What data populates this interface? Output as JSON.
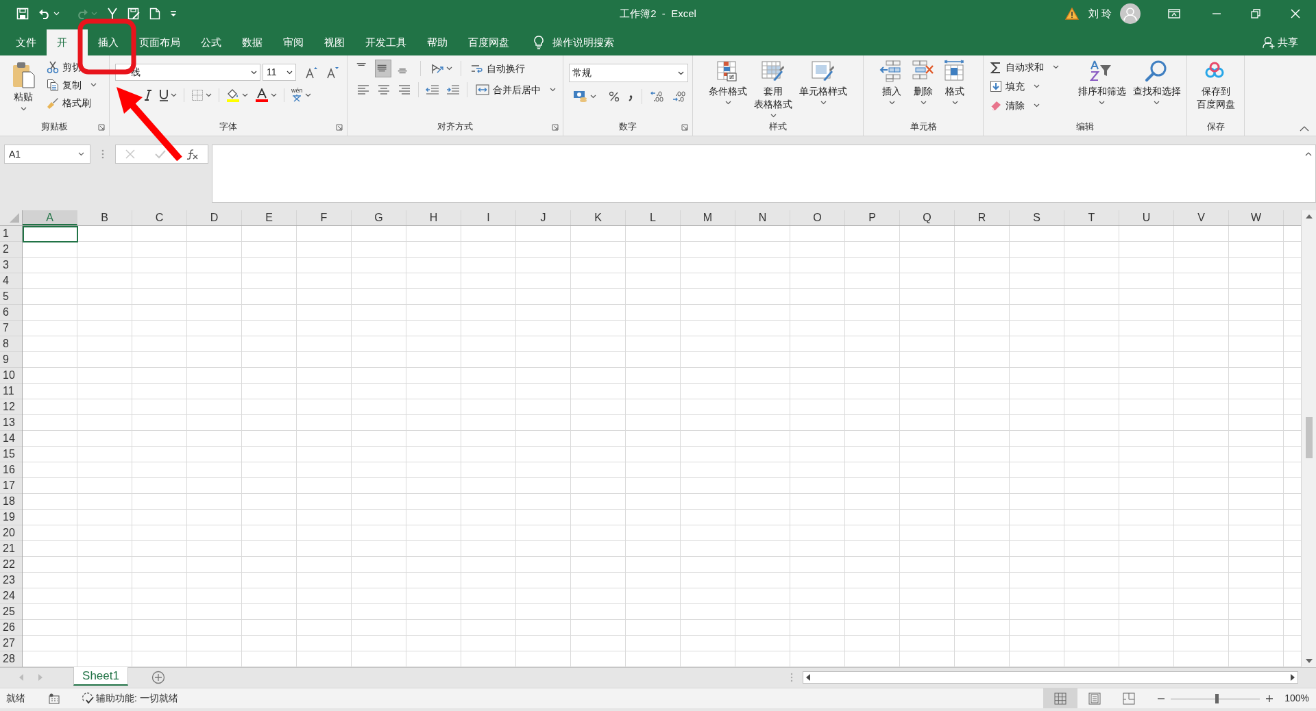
{
  "window": {
    "title": "工作簿2  -  Excel",
    "user": "刘 玲"
  },
  "menu_tabs": [
    {
      "label": "文件",
      "selected": false
    },
    {
      "label": "开",
      "selected": true
    },
    {
      "label": "插入",
      "selected": false
    },
    {
      "label": "页面布局",
      "selected": false
    },
    {
      "label": "公式",
      "selected": false
    },
    {
      "label": "数据",
      "selected": false
    },
    {
      "label": "审阅",
      "selected": false
    },
    {
      "label": "视图",
      "selected": false
    },
    {
      "label": "开发工具",
      "selected": false
    },
    {
      "label": "帮助",
      "selected": false
    },
    {
      "label": "百度网盘",
      "selected": false
    }
  ],
  "tell_me": "操作说明搜索",
  "share": "共享",
  "ribbon_groups": [
    {
      "kind": "clipboard",
      "title": "剪贴板",
      "paste": "粘贴",
      "small": [
        {
          "label": "剪切",
          "dropdown": false
        },
        {
          "label": "复制",
          "dropdown": true
        },
        {
          "label": "格式刷",
          "dropdown": false
        }
      ]
    },
    {
      "kind": "font",
      "title": "字体",
      "font": "线",
      "size": "11",
      "wen": "wén"
    },
    {
      "kind": "alignment",
      "title": "对齐方式",
      "vertical_align": [
        {
          "selected": false
        },
        {
          "selected": true
        },
        {
          "selected": false
        }
      ],
      "wrap": "自动换行",
      "merge": "合并后居中"
    },
    {
      "kind": "number",
      "title": "数字",
      "format": "常规"
    },
    {
      "kind": "buttons",
      "title": "样式",
      "items": [
        {
          "kind": "large",
          "label": "条件格式",
          "dropdown": true
        },
        {
          "kind": "large",
          "lines": [
            "套用",
            "表格格式"
          ],
          "dropdown": true
        },
        {
          "kind": "large",
          "label": "单元格样式",
          "dropdown": true
        }
      ]
    },
    {
      "kind": "buttons",
      "title": "单元格",
      "items": [
        {
          "kind": "large",
          "label": "插入",
          "dropdown": true
        },
        {
          "kind": "large",
          "label": "删除",
          "dropdown": true
        },
        {
          "kind": "large",
          "label": "格式",
          "dropdown": true
        }
      ]
    },
    {
      "kind": "buttons",
      "title": "编辑",
      "items": [
        {
          "kind": "stack",
          "items": [
            {
              "label": "自动求和",
              "dropdown": true
            },
            {
              "label": "填充",
              "dropdown": true
            },
            {
              "label": "清除",
              "dropdown": true
            }
          ]
        },
        {
          "kind": "large",
          "label": "排序和筛选",
          "dropdown": true
        },
        {
          "kind": "large",
          "label": "查找和选择",
          "dropdown": true
        }
      ]
    },
    {
      "kind": "buttons",
      "title": "保存",
      "items": [
        {
          "kind": "large",
          "lines": [
            "保存到",
            "百度网盘"
          ],
          "dropdown": false
        }
      ]
    }
  ],
  "name_box": "A1",
  "columns": [
    {
      "label": "A",
      "selected": true
    },
    {
      "label": "B",
      "selected": false
    },
    {
      "label": "C",
      "selected": false
    },
    {
      "label": "D",
      "selected": false
    },
    {
      "label": "E",
      "selected": false
    },
    {
      "label": "F",
      "selected": false
    },
    {
      "label": "G",
      "selected": false
    },
    {
      "label": "H",
      "selected": false
    },
    {
      "label": "I",
      "selected": false
    },
    {
      "label": "J",
      "selected": false
    },
    {
      "label": "K",
      "selected": false
    },
    {
      "label": "L",
      "selected": false
    },
    {
      "label": "M",
      "selected": false
    },
    {
      "label": "N",
      "selected": false
    },
    {
      "label": "O",
      "selected": false
    },
    {
      "label": "P",
      "selected": false
    },
    {
      "label": "Q",
      "selected": false
    },
    {
      "label": "R",
      "selected": false
    },
    {
      "label": "S",
      "selected": false
    },
    {
      "label": "T",
      "selected": false
    },
    {
      "label": "U",
      "selected": false
    },
    {
      "label": "V",
      "selected": false
    },
    {
      "label": "W",
      "selected": false
    }
  ],
  "rows": [
    "1",
    "2",
    "3",
    "4",
    "5",
    "6",
    "7",
    "8",
    "9",
    "10",
    "11",
    "12",
    "13",
    "14",
    "15",
    "16",
    "17",
    "18",
    "19",
    "20",
    "21",
    "22",
    "23",
    "24",
    "25",
    "26",
    "27",
    "28"
  ],
  "sheets": [
    {
      "label": "Sheet1",
      "selected": true
    }
  ],
  "status_bar": {
    "ready": "就绪",
    "accessibility": "辅助功能: 一切就绪",
    "views": [
      {
        "selected": true
      },
      {
        "selected": false
      },
      {
        "selected": false
      }
    ],
    "zoom": {
      "level": 0.52,
      "reading": "100%"
    }
  },
  "annotations": {
    "highlight_box": true,
    "arrow": true
  }
}
